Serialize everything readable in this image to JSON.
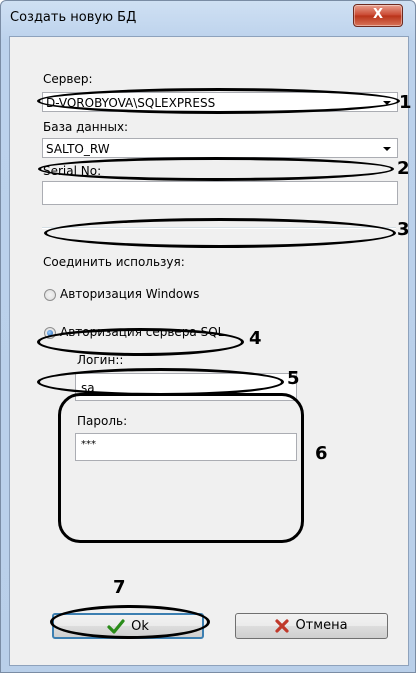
{
  "window": {
    "title": "Создать новую БД",
    "close_glyph": "X"
  },
  "server": {
    "label": "Сервер:",
    "value": "D-VOROBYOVA\\SQLEXPRESS"
  },
  "database": {
    "label": "База данных:",
    "value": "SALTO_RW"
  },
  "serial": {
    "label": "Serial No:",
    "value": ""
  },
  "connect": {
    "label": "Соединить используя:",
    "windows_auth": {
      "label": "Авторизация Windows",
      "selected": false
    },
    "sql_auth": {
      "label": "Авторизация сервера SQL",
      "selected": true
    }
  },
  "login": {
    "label": "Логин::",
    "value": "sa"
  },
  "password": {
    "label": "Пароль:",
    "value": "***"
  },
  "buttons": {
    "ok_label": "Ok",
    "cancel_label": "Отмена"
  },
  "annotations": [
    "1",
    "2",
    "3",
    "4",
    "5",
    "6",
    "7"
  ],
  "colors": {
    "ok_check": "#2a8c1a",
    "cancel_x": "#c0392b",
    "close_button": "#c9462f"
  }
}
